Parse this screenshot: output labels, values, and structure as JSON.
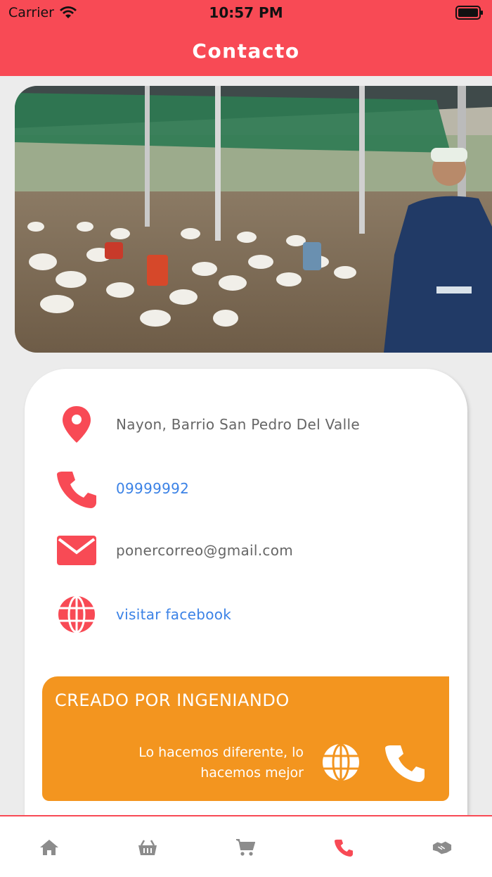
{
  "status_bar": {
    "carrier": "Carrier",
    "time": "10:57 PM"
  },
  "header": {
    "title": "Contacto"
  },
  "hero": {
    "description_icon": "farm-photo"
  },
  "contact": {
    "address": "Nayon, Barrio San Pedro Del Valle",
    "phone": "09999992",
    "email": "ponercorreo@gmail.com",
    "facebook": "visitar facebook"
  },
  "promo": {
    "title": "CREADO POR INGENIANDO",
    "subtitle": "Lo hacemos diferente, lo hacemos mejor"
  },
  "bottom_nav": {
    "items": [
      "home-icon",
      "basket-icon",
      "cart-icon",
      "phone-icon",
      "handshake-icon"
    ],
    "active": "phone-icon"
  },
  "colors": {
    "accent": "#f84a55",
    "promo": "#f3951f",
    "link": "#3b82e6"
  }
}
